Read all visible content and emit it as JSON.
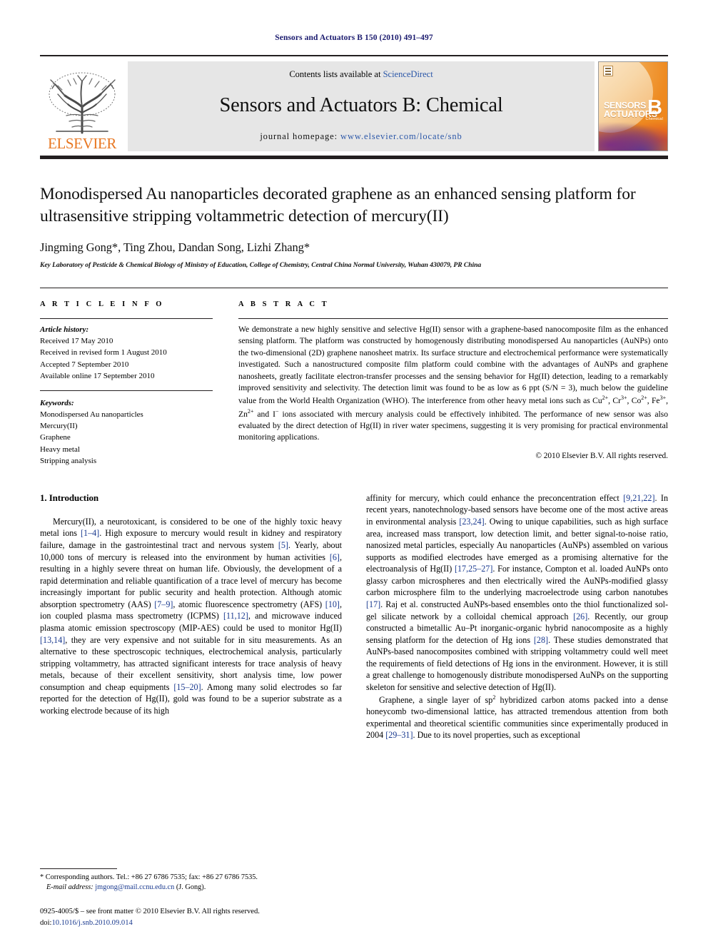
{
  "running_head": "Sensors and Actuators B 150 (2010) 491–497",
  "masthead": {
    "contents_prefix": "Contents lists available at ",
    "contents_link": "ScienceDirect",
    "journal_title": "Sensors and Actuators B: Chemical",
    "homepage_prefix": "journal homepage: ",
    "homepage_url": "www.elsevier.com/locate/snb",
    "publisher_wordmark": "ELSEVIER",
    "cover": {
      "line1": "SENSORS",
      "line1_small": "and",
      "line2": "ACTUATORS",
      "letter": "B",
      "subtitle": "Chemical"
    },
    "link_color": "#2b57a8"
  },
  "article": {
    "title": "Monodispersed Au nanoparticles decorated graphene as an enhanced sensing platform for ultrasensitive stripping voltammetric detection of mercury(II)",
    "authors": "Jingming Gong*, Ting Zhou, Dandan Song, Lizhi Zhang*",
    "affiliation": "Key Laboratory of Pesticide & Chemical Biology of Ministry of Education, College of Chemistry, Central China Normal University, Wuhan 430079, PR China"
  },
  "article_info": {
    "heading": "A R T I C L E   I N F O",
    "history_label": "Article history:",
    "history": [
      "Received 17 May 2010",
      "Received in revised form 1 August 2010",
      "Accepted 7 September 2010",
      "Available online 17 September 2010"
    ],
    "keywords_label": "Keywords:",
    "keywords": [
      "Monodispersed Au nanoparticles",
      "Mercury(II)",
      "Graphene",
      "Heavy metal",
      "Stripping analysis"
    ]
  },
  "abstract": {
    "heading": "A B S T R A C T",
    "text_part1": "We demonstrate a new highly sensitive and selective Hg(II) sensor with a graphene-based nanocomposite film as the enhanced sensing platform. The platform was constructed by homogenously distributing monodispersed Au nanoparticles (AuNPs) onto the two-dimensional (2D) graphene nanosheet matrix. Its surface structure and electrochemical performance were systematically investigated. Such a nanostructured composite film platform could combine with the advantages of AuNPs and graphene nanosheets, greatly facilitate electron-transfer processes and the sensing behavior for Hg(II) detection, leading to a remarkably improved sensitivity and selectivity. The detection limit was found to be as low as 6 ppt (S/N = 3), much below the guideline value from the World Health Organization (WHO). The interference from other heavy metal ions such as Cu",
    "ion1_sup": "2+",
    "ion_sep1": ", Cr",
    "ion2_sup": "3+",
    "ion_sep2": ", Co",
    "ion3_sup": "2+",
    "ion_sep3": ", Fe",
    "ion4_sup": "3+",
    "ion_sep4": ", Zn",
    "ion5_sup": "2+",
    "text_part2": " and I",
    "ion6_sup": "−",
    "text_part3": " ions associated with mercury analysis could be effectively inhibited. The performance of new sensor was also evaluated by the direct detection of Hg(II) in river water specimens, suggesting it is very promising for practical environmental monitoring applications.",
    "copyright": "© 2010 Elsevier B.V. All rights reserved."
  },
  "introduction": {
    "section_number_title": "1.  Introduction",
    "left_p1_a": "Mercury(II), a neurotoxicant, is considered to be one of the highly toxic heavy metal ions ",
    "left_ref1": "[1–4]",
    "left_p1_b": ". High exposure to mercury would result in kidney and respiratory failure, damage in the gastrointestinal tract and nervous system ",
    "left_ref2": "[5]",
    "left_p1_c": ". Yearly, about 10,000 tons of mercury is released into the environment by human activities ",
    "left_ref3": "[6]",
    "left_p1_d": ", resulting in a highly severe threat on human life. Obviously, the development of a rapid determination and reliable quantification of a trace level of mercury has become increasingly important for public security and health protection. Although atomic absorption spectrometry (AAS) ",
    "left_ref4": "[7–9]",
    "left_p1_e": ", atomic fluorescence spectrometry (AFS) ",
    "left_ref5": "[10]",
    "left_p1_f": ", ion coupled plasma mass spectrometry (ICPMS) ",
    "left_ref6": "[11,12]",
    "left_p1_g": ", and microwave induced plasma atomic emission spectroscopy (MIP-AES) could be used to monitor Hg(II) ",
    "left_ref7": "[13,14]",
    "left_p1_h": ", they are very expensive and not suitable for in situ measurements. As an alternative to these spectroscopic techniques, electrochemical analysis, particularly stripping voltammetry, has attracted significant interests for trace analysis of heavy metals, because of their excellent sensitivity, short analysis time, low power consumption and cheap equipments ",
    "left_ref8": "[15–20]",
    "left_p1_i": ". Among many solid electrodes so far reported for the detection of Hg(II), gold was found to be a superior substrate as a working electrode because of its high",
    "right_p1_a": "affinity for mercury, which could enhance the preconcentration effect ",
    "right_ref1": "[9,21,22]",
    "right_p1_b": ". In recent years, nanotechnology-based sensors have become one of the most active areas in environmental analysis ",
    "right_ref2": "[23,24]",
    "right_p1_c": ". Owing to unique capabilities, such as high surface area, increased mass transport, low detection limit, and better signal-to-noise ratio, nanosized metal particles, especially Au nanoparticles (AuNPs) assembled on various supports as modified electrodes have emerged as a promising alternative for the electroanalysis of Hg(II) ",
    "right_ref3": "[17,25–27]",
    "right_p1_d": ". For instance, Compton et al. loaded AuNPs onto glassy carbon microspheres and then electrically wired the AuNPs-modified glassy carbon microsphere film to the underlying macroelectrode using carbon nanotubes ",
    "right_ref4": "[17]",
    "right_p1_e": ". Raj et al. constructed AuNPs-based ensembles onto the thiol functionalized sol-gel silicate network by a colloidal chemical approach ",
    "right_ref5": "[26]",
    "right_p1_f": ". Recently, our group constructed a bimetallic Au–Pt inorganic-organic hybrid nanocomposite as a highly sensing platform for the detection of Hg ions ",
    "right_ref6": "[28]",
    "right_p1_g": ". These studies demonstrated that AuNPs-based nanocomposites combined with stripping voltammetry could well meet the requirements of field detections of Hg ions in the environment. However, it is still a great challenge to homogenously distribute monodispersed AuNPs on the supporting skeleton for sensitive and selective detection of Hg(II).",
    "right_p2_a": "Graphene, a single layer of sp",
    "right_p2_sup": "2",
    "right_p2_b": " hybridized carbon atoms packed into a dense honeycomb two-dimensional lattice, has attracted tremendous attention from both experimental and theoretical scientific communities since experimentally produced in 2004 ",
    "right_ref7": "[29–31]",
    "right_p2_c": ". Due to its novel properties, such as exceptional"
  },
  "footnotes": {
    "corresponding": "* Corresponding authors. Tel.: +86 27 6786 7535; fax: +86 27 6786 7535.",
    "email_label": "E-mail address:",
    "email": "jmgong@mail.ccnu.edu.cn",
    "email_suffix": "(J. Gong)."
  },
  "imprint": {
    "line1": "0925-4005/$ – see front matter © 2010 Elsevier B.V. All rights reserved.",
    "doi_label": "doi:",
    "doi": "10.1016/j.snb.2010.09.014"
  }
}
